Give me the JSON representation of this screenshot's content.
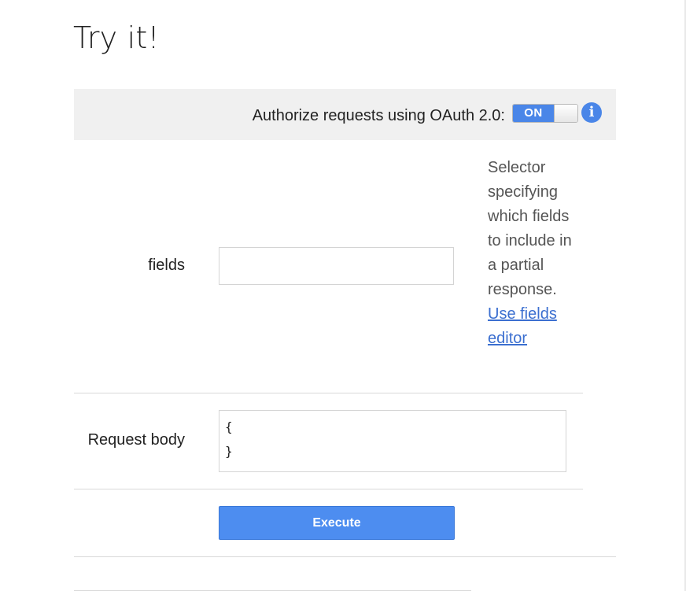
{
  "page": {
    "title": "Try it!"
  },
  "auth": {
    "label": "Authorize requests using OAuth 2.0:",
    "toggle_state_label": "ON",
    "toggle_on": true,
    "info_icon": "info-icon",
    "info_glyph": "i",
    "accent_color": "#4a86e8"
  },
  "params": [
    {
      "name": "fields",
      "value": "",
      "description": "Selector specifying which fields to include in a partial response.",
      "link_label": "Use fields editor"
    }
  ],
  "request_body": {
    "label": "Request body",
    "value": "{\n}"
  },
  "actions": {
    "execute_label": "Execute"
  }
}
